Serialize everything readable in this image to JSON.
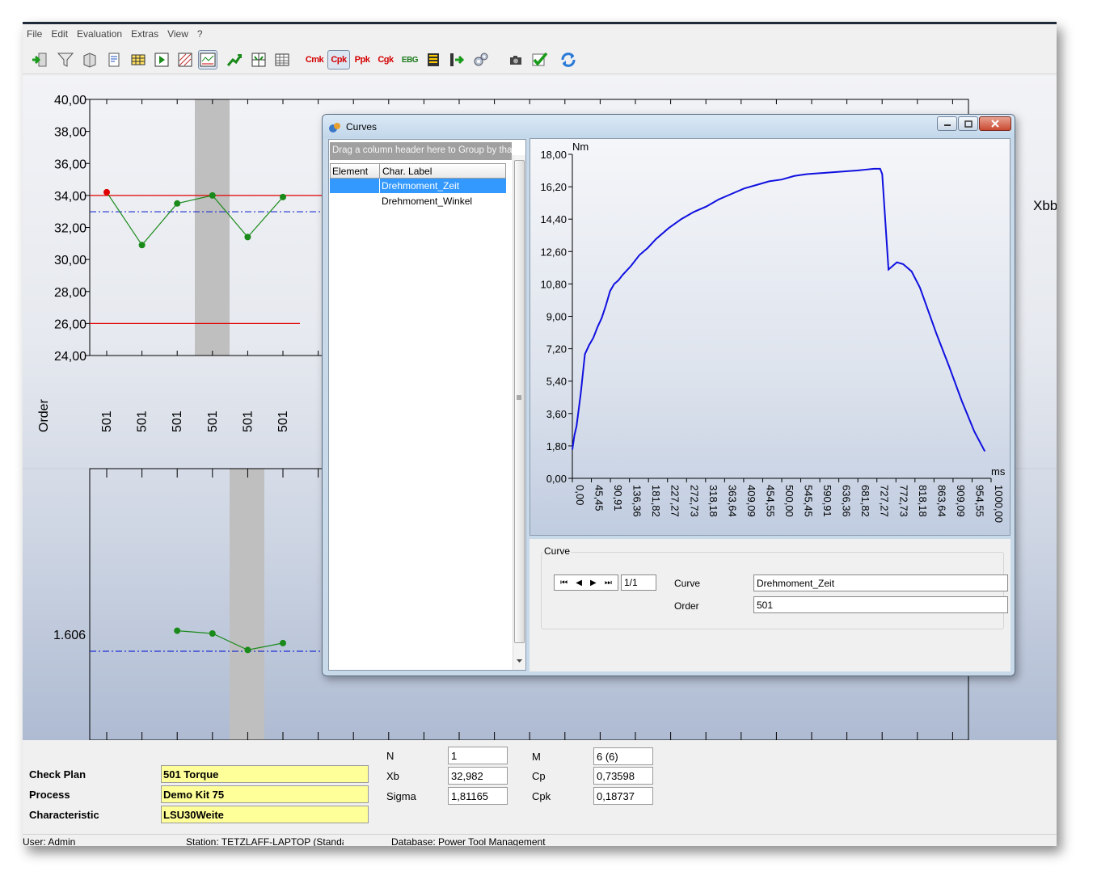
{
  "menu": [
    "File",
    "Edit",
    "Evaluation",
    "Extras",
    "View",
    "?"
  ],
  "toolbar": {
    "cmk_label": "Cmk",
    "cpk_label": "Cpk",
    "ppk_label": "Ppk",
    "cgk_label": "Cgk",
    "ebg_label": "EBG"
  },
  "main_chart": {
    "y_ticks": [
      "40,00",
      "38,00",
      "36,00",
      "34,00",
      "32,00",
      "30,00",
      "28,00",
      "26,00",
      "24,00"
    ],
    "ylim": [
      24,
      40
    ],
    "values": [
      34.2,
      30.9,
      33.5,
      34.0,
      31.4,
      33.9
    ],
    "first_point_color": "#e00000",
    "point_color": "#1a8a1a",
    "upper_limit": 34.0,
    "lower_limit": 26.0,
    "mean": 32.982,
    "order_label": "Order",
    "order_values": [
      "501",
      "501",
      "501",
      "501",
      "501",
      "501"
    ],
    "right_label": "Xbb",
    "lower_value_label": "1.606",
    "lower_values": [
      0.62,
      0.6,
      0.48,
      0.53
    ],
    "highlight_color": "#bfbfbf"
  },
  "info": {
    "check_plan_label": "Check Plan",
    "check_plan_value": "501 Torque",
    "process_label": "Process",
    "process_value": "Demo Kit 75",
    "characteristic_label": "Characteristic",
    "characteristic_value": "LSU30Weite",
    "n_label": "N",
    "n_value": "1",
    "xb_label": "Xb",
    "xb_value": "32,982",
    "sigma_label": "Sigma",
    "sigma_value": "1,81165",
    "m_label": "M",
    "m_value": "6 (6)",
    "cp_label": "Cp",
    "cp_value": "0,73598",
    "cpk_label": "Cpk",
    "cpk_value": "0,18737"
  },
  "status": {
    "user": "User: Admin",
    "station": "Station: TETZLAFF-LAPTOP (Standard)",
    "database": "Database: Power Tool Management"
  },
  "curves_dialog": {
    "title": "Curves",
    "group_hint": "Drag a column header here to Group by that column",
    "columns": [
      "Element",
      "Char. Label"
    ],
    "rows": [
      "Drehmoment_Zeit",
      "Drehmoment_Winkel"
    ],
    "selected_row": 0,
    "curve_group_title": "Curve",
    "nav_position": "1/1",
    "curve_label": "Curve",
    "curve_value": "Drehmoment_Zeit",
    "order_label": "Order",
    "order_value": "501"
  },
  "chart_data": {
    "type": "line",
    "title": "",
    "ylabel": "Nm",
    "xlabel": "ms",
    "ylim": [
      0,
      18
    ],
    "xlim": [
      0,
      1000
    ],
    "y_ticks": [
      "18,00",
      "16,20",
      "14,40",
      "12,60",
      "10,80",
      "9,00",
      "7,20",
      "5,40",
      "3,60",
      "1,80",
      "0,00"
    ],
    "x_ticks": [
      "0,00",
      "45,45",
      "90,91",
      "136,36",
      "181,82",
      "227,27",
      "272,73",
      "318,18",
      "363,64",
      "409,09",
      "454,55",
      "500,00",
      "545,45",
      "590,91",
      "636,36",
      "681,82",
      "727,27",
      "772,73",
      "818,18",
      "863,64",
      "909,09",
      "954,55",
      "1000,00"
    ],
    "series": [
      {
        "color": "#1010e0",
        "x": [
          0,
          5,
          10,
          20,
          30,
          40,
          50,
          60,
          70,
          80,
          90,
          100,
          110,
          120,
          140,
          160,
          180,
          200,
          230,
          260,
          290,
          320,
          350,
          380,
          410,
          440,
          470,
          500,
          530,
          560,
          590,
          620,
          650,
          680,
          700,
          720,
          735,
          740,
          755,
          775,
          790,
          810,
          830,
          850,
          870,
          900,
          930,
          960,
          985
        ],
        "y": [
          1.6,
          2.4,
          2.9,
          4.7,
          6.9,
          7.4,
          7.8,
          8.4,
          8.9,
          9.6,
          10.4,
          10.8,
          11.0,
          11.3,
          11.8,
          12.4,
          12.8,
          13.3,
          13.9,
          14.4,
          14.8,
          15.1,
          15.5,
          15.8,
          16.1,
          16.3,
          16.5,
          16.6,
          16.8,
          16.9,
          16.95,
          17.0,
          17.05,
          17.1,
          17.15,
          17.2,
          17.2,
          16.9,
          11.6,
          12.0,
          11.9,
          11.5,
          10.6,
          9.3,
          8.0,
          6.2,
          4.3,
          2.6,
          1.5
        ]
      }
    ]
  }
}
